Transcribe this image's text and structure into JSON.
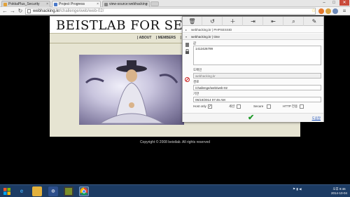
{
  "browser": {
    "tabs": [
      {
        "label": "PokkaPlus_Security"
      },
      {
        "label": "Project Progress"
      },
      {
        "label": "view-source:webhacking"
      }
    ],
    "address": {
      "host": "webhacking.kr",
      "path": "/challenge/web/web-02/"
    },
    "window_buttons": {
      "minimize": "–",
      "maximize": "□",
      "close": "✕"
    }
  },
  "page": {
    "site_title": "BEISTLAB FOR SECUR",
    "nav": [
      "| ABOUT",
      "| MEMBERS",
      "| B"
    ],
    "footer": "Copyright © 2008 beistlab. All rights reserved"
  },
  "cookie_editor": {
    "breadcrumb": "webhacking.kr | PHPSESSID",
    "selected": "webhacking.kr | time",
    "value_label": "값",
    "value": "1412426799",
    "domain_label": "도메인",
    "domain": "webhacking.kr",
    "path_label": "경로",
    "path": "/challenge/web/web-02",
    "expires_label": "기한",
    "expires": "05/10/2014 07:45 AM",
    "host_only_label": "Host only",
    "host_only_checked": true,
    "session_label": "세션",
    "secure_label": "Secure",
    "httponly_label": "HTTP 전용",
    "help_label": "도움말"
  },
  "taskbar": {
    "clock_time": "오후 9:46",
    "clock_date": "2014-10-04"
  }
}
